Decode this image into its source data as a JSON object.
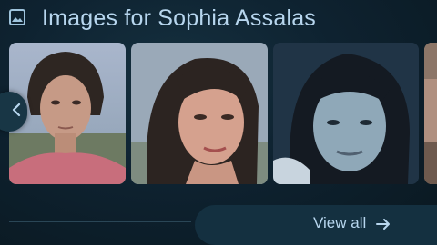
{
  "header": {
    "title": "Images for Sophia Assalas",
    "icon": "image-icon"
  },
  "carousel": {
    "images": [
      {
        "name": "image-thumbnail-1"
      },
      {
        "name": "image-thumbnail-2"
      },
      {
        "name": "image-thumbnail-3"
      },
      {
        "name": "image-thumbnail-4"
      }
    ],
    "prev_icon": "chevron-left-icon"
  },
  "footer": {
    "view_all_label": "View all",
    "arrow_icon": "arrow-right-icon"
  },
  "colors": {
    "background": "#0c1a24",
    "text": "#b7d6ee",
    "button": "#143040"
  }
}
